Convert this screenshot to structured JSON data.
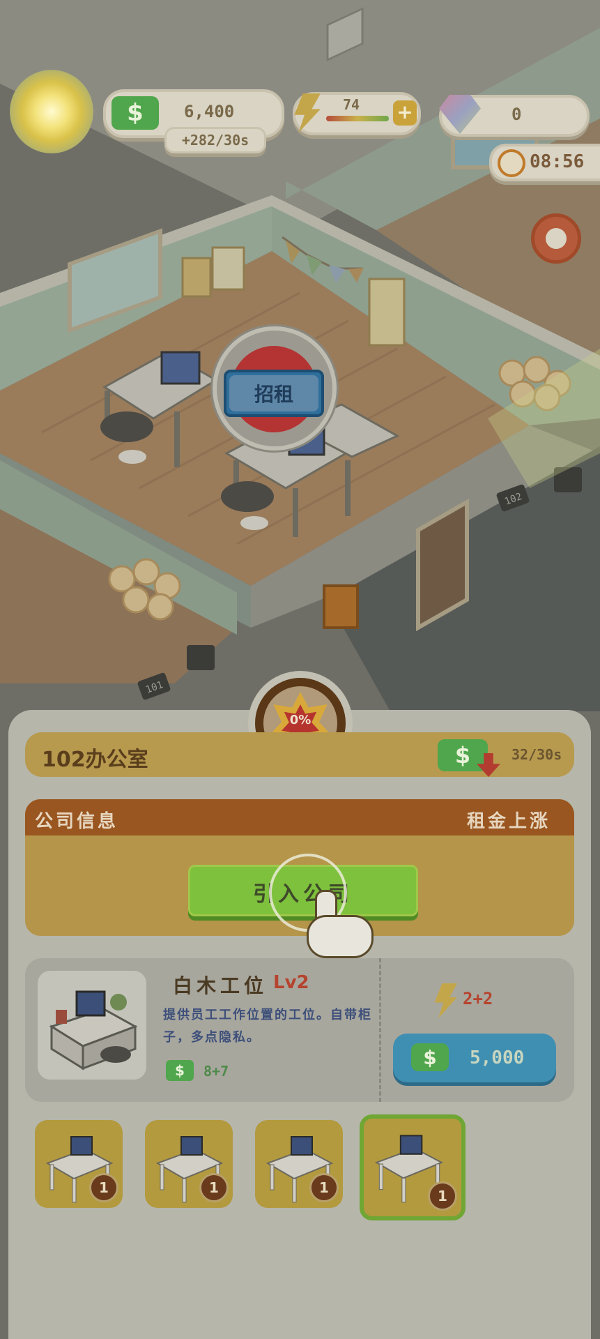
{
  "hud": {
    "cash_value": "6,400",
    "cash_rate": "+282/30s",
    "energy_value": "74",
    "gems_value": "0",
    "timer": "08:56",
    "cash_symbol": "$",
    "plus_symbol": "+"
  },
  "scene": {
    "rent_sign": "招租",
    "room_101": "101",
    "room_102": "102"
  },
  "panel": {
    "progress": "0%",
    "room_title": "102办公室",
    "income_rate": "32/30s",
    "company_info_label": "公司信息",
    "rent_rise_label": "租金上涨",
    "intro_button": "引入公司",
    "item": {
      "name": "白木工位",
      "level": "Lv2",
      "description": "提供员工工作位置的工位。自带柜子，多点隐私。",
      "income": "8+7",
      "energy": "2+2",
      "cost": "5,000"
    },
    "slots": [
      {
        "badge": "1"
      },
      {
        "badge": "1"
      },
      {
        "badge": "1"
      },
      {
        "badge": "1"
      }
    ]
  },
  "colors": {
    "accent_green": "#7ec13c",
    "cost_blue": "#3f8fb2",
    "header_orange": "#a95a1c",
    "level_red": "#b5442e"
  }
}
